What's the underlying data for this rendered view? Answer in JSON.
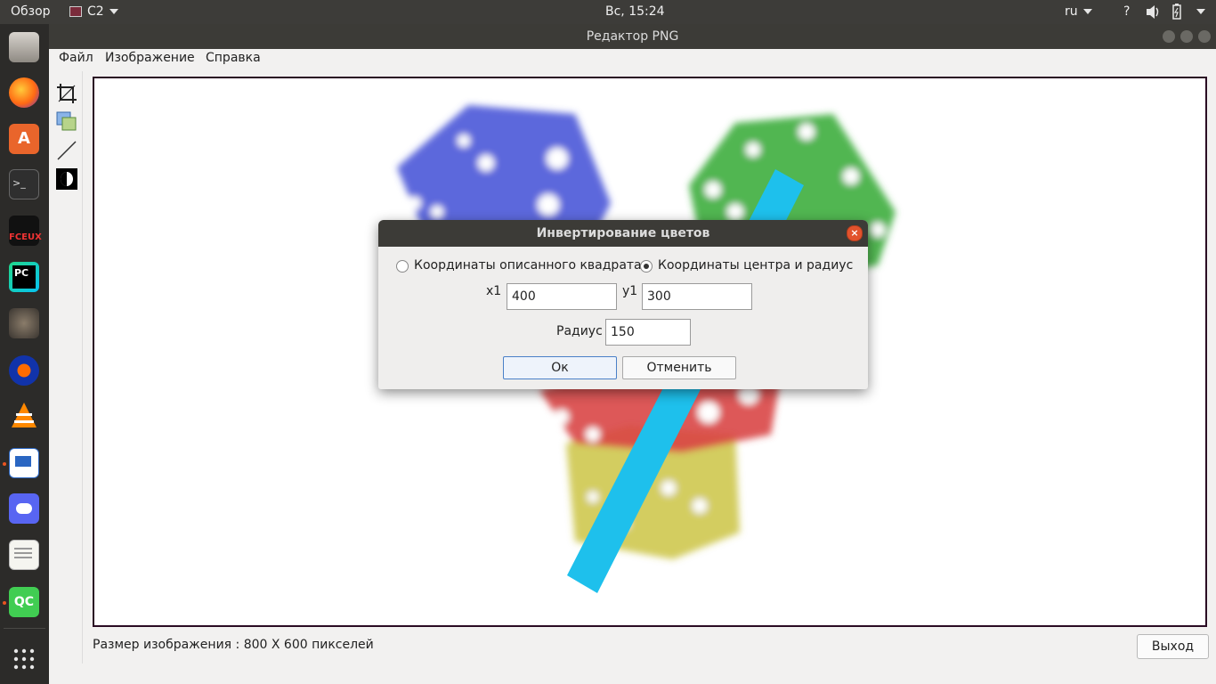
{
  "topbar": {
    "activities": "Обзор",
    "app_menu": "C2",
    "clock": "Вс, 15:24",
    "keyboard_layout": "ru",
    "help": "?"
  },
  "window": {
    "title": "Редактор PNG",
    "menu": [
      "Файл",
      "Изображение",
      "Справка"
    ],
    "status": "Размер изображения : 800 X 600 пикселей",
    "exit_label": "Выход"
  },
  "dialog": {
    "title": "Инвертирование цветов",
    "option_square": "Координаты описанного квадрата",
    "option_center": "Координаты центра и радиус",
    "selected_option": "center",
    "x1_label": "x1",
    "x1_value": "400",
    "y1_label": "y1",
    "y1_value": "300",
    "radius_label": "Радиус",
    "radius_value": "150",
    "ok_label": "Ок",
    "cancel_label": "Отменить"
  },
  "dock_icons": [
    "files-icon",
    "firefox-icon",
    "software-center-icon",
    "terminal-icon",
    "fceux-icon",
    "pycharm-icon",
    "gimp-icon",
    "audacity-icon",
    "vlc-icon",
    "writer-icon",
    "discord-icon",
    "text-editor-icon",
    "qt-creator-icon",
    "app-grid-icon"
  ],
  "colors": {
    "accent_dot": "#e95420",
    "stripe": "#1ec0ec"
  }
}
